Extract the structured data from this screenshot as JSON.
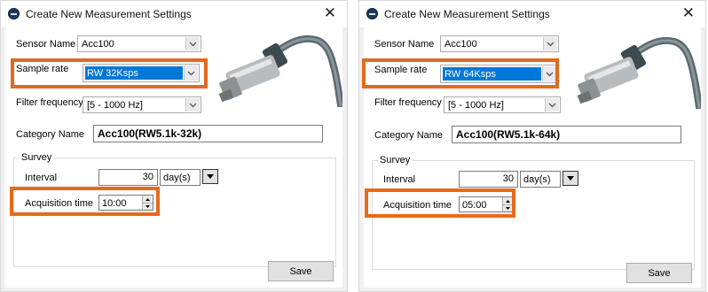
{
  "panels": [
    {
      "title": "Create New Measurement Settings",
      "sensor_name_label": "Sensor Name",
      "sensor_name_value": "Acc100",
      "sample_rate_label": "Sample rate",
      "sample_rate_value": "RW 32Ksps",
      "filter_frequency_label": "Filter frequency",
      "filter_frequency_value": "[5 - 1000 Hz]",
      "category_name_label": "Category Name",
      "category_name_value": "Acc100(RW5.1k-32k)",
      "survey_title": "Survey",
      "interval_label": "Interval",
      "interval_value": "30",
      "interval_unit": "day(s)",
      "acquisition_time_label": "Acquisition time",
      "acquisition_time_value": "10:00",
      "save_label": "Save"
    },
    {
      "title": "Create New Measurement Settings",
      "sensor_name_label": "Sensor Name",
      "sensor_name_value": "Acc100",
      "sample_rate_label": "Sample rate",
      "sample_rate_value": "RW 64Ksps",
      "filter_frequency_label": "Filter frequency",
      "filter_frequency_value": "[5 - 1000 Hz]",
      "category_name_label": "Category Name",
      "category_name_value": "Acc100(RW5.1k-64k)",
      "survey_title": "Survey",
      "interval_label": "Interval",
      "interval_value": "30",
      "interval_unit": "day(s)",
      "acquisition_time_label": "Acquisition time",
      "acquisition_time_value": "05:00",
      "save_label": "Save"
    }
  ],
  "colors": {
    "highlight": "#e56a1c",
    "selection": "#0078d7"
  },
  "icons": [
    "app-logo-icon",
    "close-icon",
    "chevron-down-icon",
    "spin-up-icon",
    "spin-down-icon",
    "sensor-image"
  ]
}
